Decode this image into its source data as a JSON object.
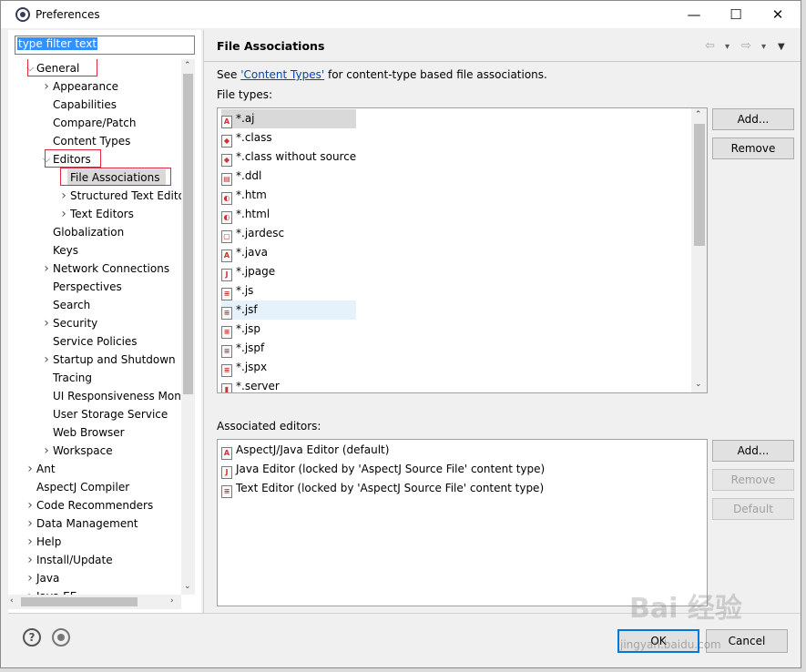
{
  "window": {
    "title": "Preferences",
    "minimize": "—",
    "maximize": "☐",
    "close": "✕"
  },
  "filter": {
    "value": "type filter text"
  },
  "tree": [
    {
      "label": "General",
      "level": 0,
      "expander": "⌵"
    },
    {
      "label": "Appearance",
      "level": 1,
      "expander": "›"
    },
    {
      "label": "Capabilities",
      "level": 1,
      "expander": ""
    },
    {
      "label": "Compare/Patch",
      "level": 1,
      "expander": ""
    },
    {
      "label": "Content Types",
      "level": 1,
      "expander": ""
    },
    {
      "label": "Editors",
      "level": 1,
      "expander": "⌵"
    },
    {
      "label": "File Associations",
      "level": 2,
      "expander": ""
    },
    {
      "label": "Structured Text Editors",
      "level": 2,
      "expander": "›"
    },
    {
      "label": "Text Editors",
      "level": 2,
      "expander": "›"
    },
    {
      "label": "Globalization",
      "level": 1,
      "expander": ""
    },
    {
      "label": "Keys",
      "level": 1,
      "expander": ""
    },
    {
      "label": "Network Connections",
      "level": 1,
      "expander": "›"
    },
    {
      "label": "Perspectives",
      "level": 1,
      "expander": ""
    },
    {
      "label": "Search",
      "level": 1,
      "expander": ""
    },
    {
      "label": "Security",
      "level": 1,
      "expander": "›"
    },
    {
      "label": "Service Policies",
      "level": 1,
      "expander": ""
    },
    {
      "label": "Startup and Shutdown",
      "level": 1,
      "expander": "›"
    },
    {
      "label": "Tracing",
      "level": 1,
      "expander": ""
    },
    {
      "label": "UI Responsiveness Monitoring",
      "level": 1,
      "expander": ""
    },
    {
      "label": "User Storage Service",
      "level": 1,
      "expander": ""
    },
    {
      "label": "Web Browser",
      "level": 1,
      "expander": ""
    },
    {
      "label": "Workspace",
      "level": 1,
      "expander": "›"
    },
    {
      "label": "Ant",
      "level": 0,
      "expander": "›"
    },
    {
      "label": "AspectJ Compiler",
      "level": 0,
      "expander": ""
    },
    {
      "label": "Code Recommenders",
      "level": 0,
      "expander": "›"
    },
    {
      "label": "Data Management",
      "level": 0,
      "expander": "›"
    },
    {
      "label": "Help",
      "level": 0,
      "expander": "›"
    },
    {
      "label": "Install/Update",
      "level": 0,
      "expander": "›"
    },
    {
      "label": "Java",
      "level": 0,
      "expander": "›"
    },
    {
      "label": "Java EE",
      "level": 0,
      "expander": "›"
    }
  ],
  "page": {
    "title": "File Associations",
    "see_prefix": "See ",
    "see_link": "'Content Types'",
    "see_suffix": " for content-type based file associations.",
    "file_types_label": "File types:",
    "associated_label": "Associated editors:",
    "nav_back": "⇦",
    "nav_dd1": "▾",
    "nav_forward": "⇨",
    "nav_dd2": "▾",
    "nav_menu": "▼"
  },
  "file_types": [
    {
      "name": "*.aj",
      "icon": "aspectj-icon",
      "glyph": "A"
    },
    {
      "name": "*.class",
      "icon": "class-icon",
      "glyph": "◆"
    },
    {
      "name": "*.class without source",
      "icon": "class-icon",
      "glyph": "◆"
    },
    {
      "name": "*.ddl",
      "icon": "ddl-icon",
      "glyph": "▤"
    },
    {
      "name": "*.htm",
      "icon": "html-icon",
      "glyph": "◐"
    },
    {
      "name": "*.html",
      "icon": "html-icon",
      "glyph": "◐"
    },
    {
      "name": "*.jardesc",
      "icon": "jardesc-icon",
      "glyph": "▢"
    },
    {
      "name": "*.java",
      "icon": "java-icon",
      "glyph": "A"
    },
    {
      "name": "*.jpage",
      "icon": "jpage-icon",
      "glyph": "J"
    },
    {
      "name": "*.js",
      "icon": "js-icon",
      "glyph": "≡"
    },
    {
      "name": "*.jsf",
      "icon": "jsf-icon",
      "glyph": "≡"
    },
    {
      "name": "*.jsp",
      "icon": "jsp-icon",
      "glyph": "≡"
    },
    {
      "name": "*.jspf",
      "icon": "jspf-icon",
      "glyph": "≡"
    },
    {
      "name": "*.jspx",
      "icon": "jspx-icon",
      "glyph": "≡"
    },
    {
      "name": "*.server",
      "icon": "server-icon",
      "glyph": "▮"
    }
  ],
  "file_type_buttons": {
    "add": "Add...",
    "remove": "Remove"
  },
  "associated_editors": [
    {
      "name": "AspectJ/Java Editor (default)",
      "icon": "aspectj-editor-icon",
      "glyph": "A"
    },
    {
      "name": "Java Editor (locked by 'AspectJ Source File' content type)",
      "icon": "java-editor-icon",
      "glyph": "J"
    },
    {
      "name": "Text Editor (locked by 'AspectJ Source File' content type)",
      "icon": "text-editor-icon",
      "glyph": "≡"
    }
  ],
  "editor_buttons": {
    "add": "Add...",
    "remove": "Remove",
    "default": "Default"
  },
  "footer": {
    "help": "?",
    "ok": "OK",
    "cancel": "Cancel"
  },
  "watermark": {
    "main": "Bai 经验",
    "sub": "jingyan.baidu.com"
  }
}
